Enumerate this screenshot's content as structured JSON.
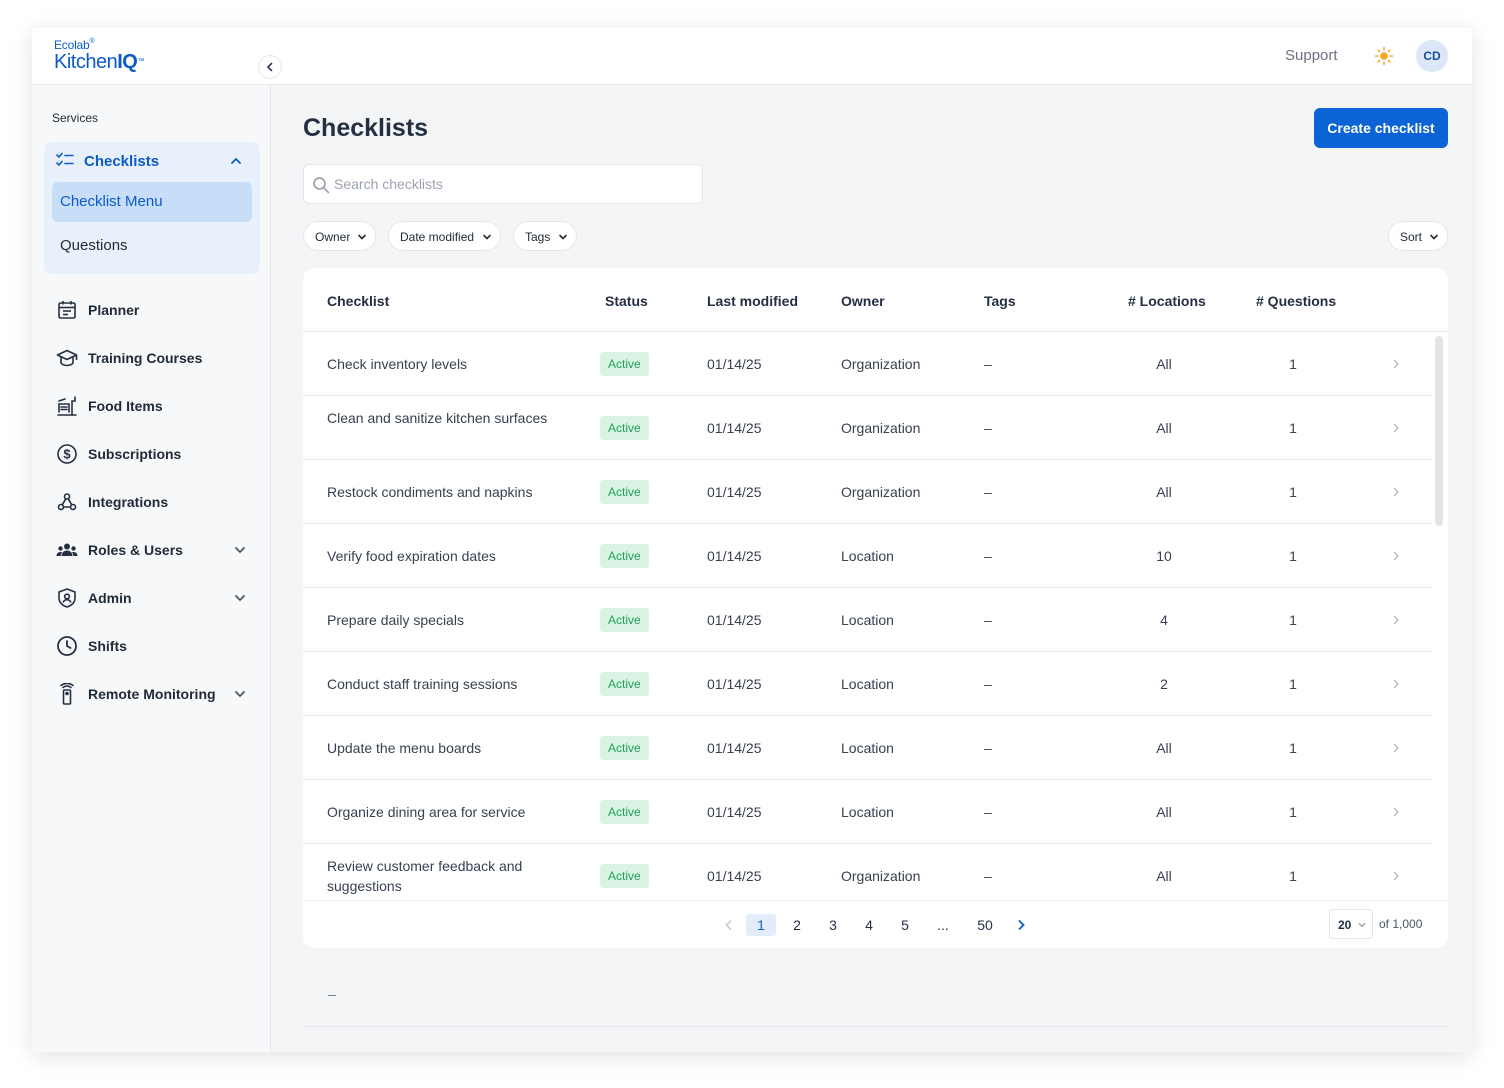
{
  "brand": {
    "line1": "Ecolab",
    "line2a": "Kitchen",
    "line2b": "IQ",
    "tm": "™"
  },
  "header": {
    "support": "Support",
    "avatar": "CD"
  },
  "sidebar": {
    "section_label": "Services",
    "group": {
      "label": "Checklists",
      "items": [
        "Checklist Menu",
        "Questions"
      ]
    },
    "items": [
      {
        "label": "Planner",
        "icon": "calendar-icon"
      },
      {
        "label": "Training Courses",
        "icon": "graduation-cap-icon"
      },
      {
        "label": "Food Items",
        "icon": "food-tray-icon"
      },
      {
        "label": "Subscriptions",
        "icon": "dollar-circle-icon"
      },
      {
        "label": "Integrations",
        "icon": "webhook-icon"
      },
      {
        "label": "Roles & Users",
        "icon": "users-icon"
      },
      {
        "label": "Admin",
        "icon": "shield-icon"
      },
      {
        "label": "Shifts",
        "icon": "clock-icon"
      },
      {
        "label": "Remote Monitoring",
        "icon": "sensor-icon"
      }
    ]
  },
  "main": {
    "title": "Checklists",
    "create_label": "Create checklist",
    "search_placeholder": "Search checklists",
    "filters": [
      "Owner",
      "Date modified",
      "Tags"
    ],
    "sort_label": "Sort"
  },
  "table": {
    "columns": [
      "Checklist",
      "Status",
      "Last modified",
      "Owner",
      "Tags",
      "# Locations",
      "# Questions"
    ],
    "rows": [
      {
        "name": "Check inventory levels",
        "status": "Active",
        "date": "01/14/25",
        "owner": "Organization",
        "tags": "–",
        "locations": "All",
        "questions": "1"
      },
      {
        "name": "Clean and sanitize kitchen surfaces",
        "status": "Active",
        "date": "01/14/25",
        "owner": "Organization",
        "tags": "–",
        "locations": "All",
        "questions": "1"
      },
      {
        "name": "Restock condiments and napkins",
        "status": "Active",
        "date": "01/14/25",
        "owner": "Organization",
        "tags": "–",
        "locations": "All",
        "questions": "1"
      },
      {
        "name": "Verify food expiration dates",
        "status": "Active",
        "date": "01/14/25",
        "owner": "Location",
        "tags": "–",
        "locations": "10",
        "questions": "1"
      },
      {
        "name": "Prepare daily specials",
        "status": "Active",
        "date": "01/14/25",
        "owner": "Location",
        "tags": "–",
        "locations": "4",
        "questions": "1"
      },
      {
        "name": "Conduct staff training sessions",
        "status": "Active",
        "date": "01/14/25",
        "owner": "Location",
        "tags": "–",
        "locations": "2",
        "questions": "1"
      },
      {
        "name": "Update the menu boards",
        "status": "Active",
        "date": "01/14/25",
        "owner": "Location",
        "tags": "–",
        "locations": "All",
        "questions": "1"
      },
      {
        "name": "Organize dining area for service",
        "status": "Active",
        "date": "01/14/25",
        "owner": "Location",
        "tags": "–",
        "locations": "All",
        "questions": "1"
      },
      {
        "name": "Review customer feedback and suggestions",
        "status": "Active",
        "date": "01/14/25",
        "owner": "Organization",
        "tags": "–",
        "locations": "All",
        "questions": "1"
      }
    ]
  },
  "pagination": {
    "pages": [
      "1",
      "2",
      "3",
      "4",
      "5",
      "...",
      "50"
    ],
    "current": "1",
    "per_page": "20",
    "total": "of 1,000"
  },
  "extra_dash": "–",
  "colors": {
    "accent": "#0b63d6",
    "active_badge_bg": "#d9f3e4",
    "active_badge_text": "#22a05b",
    "sun": "#f5a623"
  }
}
